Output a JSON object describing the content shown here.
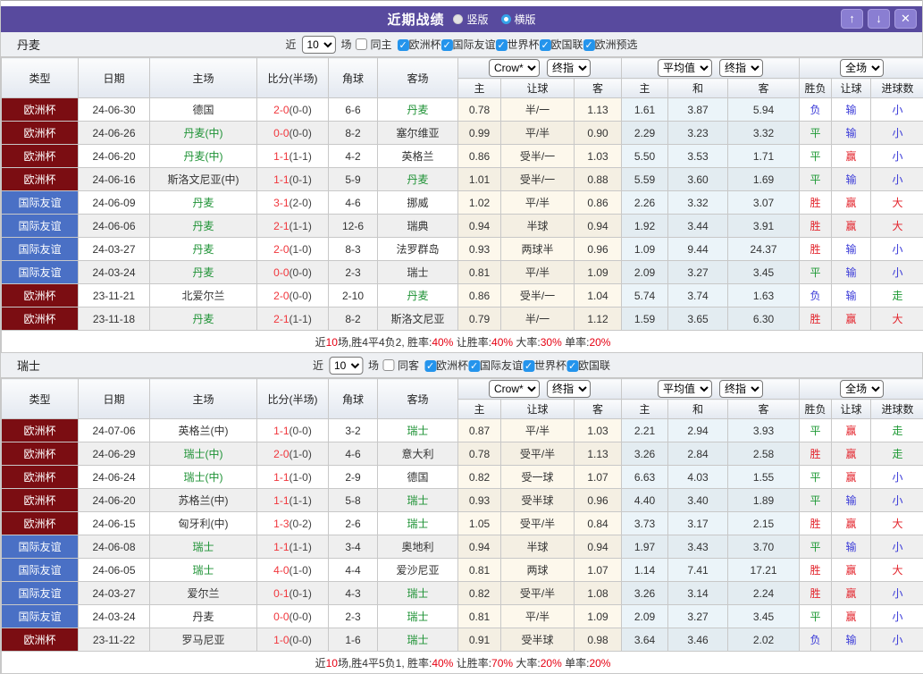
{
  "header": {
    "title": "近期战绩",
    "view_options": [
      {
        "label": "竖版",
        "selected": false
      },
      {
        "label": "横版",
        "selected": true
      }
    ],
    "window_controls": {
      "up": "↑",
      "down": "↓",
      "close": "✕"
    }
  },
  "columns": {
    "type": "类型",
    "date": "日期",
    "home": "主场",
    "score": "比分(半场)",
    "corner": "角球",
    "away": "客场",
    "odds_home": "主",
    "odds_handicap": "让球",
    "odds_away": "客",
    "avg_home": "主",
    "avg_draw": "和",
    "avg_away": "客",
    "result": "胜负",
    "result_handicap": "让球",
    "result_goals": "进球数"
  },
  "controls": {
    "bookmaker": "Crow*",
    "final_odds": "终指",
    "average": "平均值",
    "fullmatch": "全场"
  },
  "colors": {
    "accent_purple": "#584a9e",
    "europe_cup_red": "#7b0d12",
    "friendly_blue": "#4a70c5",
    "team_green": "#1e9235",
    "score_red": "#f0353b",
    "win_red": "#e3242c",
    "draw_green": "#1e9934",
    "lose_blue": "#3a3ad8",
    "summary_red": "#e60012"
  },
  "result_color_map": {
    "胜": "red",
    "赢": "red",
    "大": "red",
    "平": "green",
    "走": "green",
    "负": "blue",
    "输": "blue",
    "小": "blue"
  },
  "type_style_map": {
    "欧洲杯": "euro",
    "国际友谊": "friendly"
  },
  "sections": [
    {
      "team": "丹麦",
      "filter": {
        "near": "近",
        "count": "10",
        "games": "场",
        "same": {
          "label": "同主",
          "checked": false
        },
        "leagues": [
          {
            "label": "欧洲杯",
            "checked": true
          },
          {
            "label": "国际友谊",
            "checked": true
          },
          {
            "label": "世界杯",
            "checked": true
          },
          {
            "label": "欧国联",
            "checked": true
          },
          {
            "label": "欧洲预选",
            "checked": true
          }
        ]
      },
      "rows": [
        {
          "type": "欧洲杯",
          "date": "24-06-30",
          "home": "德国",
          "home_featured": false,
          "score_ft": "2-0",
          "score_ht": "(0-0)",
          "corner": "6-6",
          "away": "丹麦",
          "away_featured": true,
          "odds": [
            "0.78",
            "半/一",
            "1.13"
          ],
          "avg": [
            "1.61",
            "3.87",
            "5.94"
          ],
          "results": [
            "负",
            "输",
            "小"
          ]
        },
        {
          "type": "欧洲杯",
          "date": "24-06-26",
          "home": "丹麦(中)",
          "home_featured": true,
          "score_ft": "0-0",
          "score_ht": "(0-0)",
          "corner": "8-2",
          "away": "塞尔维亚",
          "away_featured": false,
          "odds": [
            "0.99",
            "平/半",
            "0.90"
          ],
          "avg": [
            "2.29",
            "3.23",
            "3.32"
          ],
          "results": [
            "平",
            "输",
            "小"
          ]
        },
        {
          "type": "欧洲杯",
          "date": "24-06-20",
          "home": "丹麦(中)",
          "home_featured": true,
          "score_ft": "1-1",
          "score_ht": "(1-1)",
          "corner": "4-2",
          "away": "英格兰",
          "away_featured": false,
          "odds": [
            "0.86",
            "受半/一",
            "1.03"
          ],
          "avg": [
            "5.50",
            "3.53",
            "1.71"
          ],
          "results": [
            "平",
            "赢",
            "小"
          ]
        },
        {
          "type": "欧洲杯",
          "date": "24-06-16",
          "home": "斯洛文尼亚(中)",
          "home_featured": false,
          "score_ft": "1-1",
          "score_ht": "(0-1)",
          "corner": "5-9",
          "away": "丹麦",
          "away_featured": true,
          "odds": [
            "1.01",
            "受半/一",
            "0.88"
          ],
          "avg": [
            "5.59",
            "3.60",
            "1.69"
          ],
          "results": [
            "平",
            "输",
            "小"
          ]
        },
        {
          "type": "国际友谊",
          "date": "24-06-09",
          "home": "丹麦",
          "home_featured": true,
          "score_ft": "3-1",
          "score_ht": "(2-0)",
          "corner": "4-6",
          "away": "挪威",
          "away_featured": false,
          "odds": [
            "1.02",
            "平/半",
            "0.86"
          ],
          "avg": [
            "2.26",
            "3.32",
            "3.07"
          ],
          "results": [
            "胜",
            "赢",
            "大"
          ]
        },
        {
          "type": "国际友谊",
          "date": "24-06-06",
          "home": "丹麦",
          "home_featured": true,
          "score_ft": "2-1",
          "score_ht": "(1-1)",
          "corner": "12-6",
          "away": "瑞典",
          "away_featured": false,
          "odds": [
            "0.94",
            "半球",
            "0.94"
          ],
          "avg": [
            "1.92",
            "3.44",
            "3.91"
          ],
          "results": [
            "胜",
            "赢",
            "大"
          ]
        },
        {
          "type": "国际友谊",
          "date": "24-03-27",
          "home": "丹麦",
          "home_featured": true,
          "score_ft": "2-0",
          "score_ht": "(1-0)",
          "corner": "8-3",
          "away": "法罗群岛",
          "away_featured": false,
          "odds": [
            "0.93",
            "两球半",
            "0.96"
          ],
          "avg": [
            "1.09",
            "9.44",
            "24.37"
          ],
          "results": [
            "胜",
            "输",
            "小"
          ]
        },
        {
          "type": "国际友谊",
          "date": "24-03-24",
          "home": "丹麦",
          "home_featured": true,
          "score_ft": "0-0",
          "score_ht": "(0-0)",
          "corner": "2-3",
          "away": "瑞士",
          "away_featured": false,
          "odds": [
            "0.81",
            "平/半",
            "1.09"
          ],
          "avg": [
            "2.09",
            "3.27",
            "3.45"
          ],
          "results": [
            "平",
            "输",
            "小"
          ]
        },
        {
          "type": "欧洲杯",
          "date": "23-11-21",
          "home": "北爱尔兰",
          "home_featured": false,
          "score_ft": "2-0",
          "score_ht": "(0-0)",
          "corner": "2-10",
          "away": "丹麦",
          "away_featured": true,
          "odds": [
            "0.86",
            "受半/一",
            "1.04"
          ],
          "avg": [
            "5.74",
            "3.74",
            "1.63"
          ],
          "results": [
            "负",
            "输",
            "走"
          ]
        },
        {
          "type": "欧洲杯",
          "date": "23-11-18",
          "home": "丹麦",
          "home_featured": true,
          "score_ft": "2-1",
          "score_ht": "(1-1)",
          "corner": "8-2",
          "away": "斯洛文尼亚",
          "away_featured": false,
          "odds": [
            "0.79",
            "半/一",
            "1.12"
          ],
          "avg": [
            "1.59",
            "3.65",
            "6.30"
          ],
          "results": [
            "胜",
            "赢",
            "大"
          ]
        }
      ],
      "summary": [
        {
          "text": "近"
        },
        {
          "text": "10",
          "red": true
        },
        {
          "text": "场,胜4平4负2, 胜率:"
        },
        {
          "text": "40%",
          "red": true
        },
        {
          "text": " 让胜率:"
        },
        {
          "text": "40%",
          "red": true
        },
        {
          "text": " 大率:"
        },
        {
          "text": "30%",
          "red": true
        },
        {
          "text": " 单率:"
        },
        {
          "text": "20%",
          "red": true
        }
      ]
    },
    {
      "team": "瑞士",
      "filter": {
        "near": "近",
        "count": "10",
        "games": "场",
        "same": {
          "label": "同客",
          "checked": false
        },
        "leagues": [
          {
            "label": "欧洲杯",
            "checked": true
          },
          {
            "label": "国际友谊",
            "checked": true
          },
          {
            "label": "世界杯",
            "checked": true
          },
          {
            "label": "欧国联",
            "checked": true
          }
        ]
      },
      "rows": [
        {
          "type": "欧洲杯",
          "date": "24-07-06",
          "home": "英格兰(中)",
          "home_featured": false,
          "score_ft": "1-1",
          "score_ht": "(0-0)",
          "corner": "3-2",
          "away": "瑞士",
          "away_featured": true,
          "odds": [
            "0.87",
            "平/半",
            "1.03"
          ],
          "avg": [
            "2.21",
            "2.94",
            "3.93"
          ],
          "results": [
            "平",
            "赢",
            "走"
          ]
        },
        {
          "type": "欧洲杯",
          "date": "24-06-29",
          "home": "瑞士(中)",
          "home_featured": true,
          "score_ft": "2-0",
          "score_ht": "(1-0)",
          "corner": "4-6",
          "away": "意大利",
          "away_featured": false,
          "odds": [
            "0.78",
            "受平/半",
            "1.13"
          ],
          "avg": [
            "3.26",
            "2.84",
            "2.58"
          ],
          "results": [
            "胜",
            "赢",
            "走"
          ]
        },
        {
          "type": "欧洲杯",
          "date": "24-06-24",
          "home": "瑞士(中)",
          "home_featured": true,
          "score_ft": "1-1",
          "score_ht": "(1-0)",
          "corner": "2-9",
          "away": "德国",
          "away_featured": false,
          "odds": [
            "0.82",
            "受一球",
            "1.07"
          ],
          "avg": [
            "6.63",
            "4.03",
            "1.55"
          ],
          "results": [
            "平",
            "赢",
            "小"
          ]
        },
        {
          "type": "欧洲杯",
          "date": "24-06-20",
          "home": "苏格兰(中)",
          "home_featured": false,
          "score_ft": "1-1",
          "score_ht": "(1-1)",
          "corner": "5-8",
          "away": "瑞士",
          "away_featured": true,
          "odds": [
            "0.93",
            "受半球",
            "0.96"
          ],
          "avg": [
            "4.40",
            "3.40",
            "1.89"
          ],
          "results": [
            "平",
            "输",
            "小"
          ]
        },
        {
          "type": "欧洲杯",
          "date": "24-06-15",
          "home": "匈牙利(中)",
          "home_featured": false,
          "score_ft": "1-3",
          "score_ht": "(0-2)",
          "corner": "2-6",
          "away": "瑞士",
          "away_featured": true,
          "odds": [
            "1.05",
            "受平/半",
            "0.84"
          ],
          "avg": [
            "3.73",
            "3.17",
            "2.15"
          ],
          "results": [
            "胜",
            "赢",
            "大"
          ]
        },
        {
          "type": "国际友谊",
          "date": "24-06-08",
          "home": "瑞士",
          "home_featured": true,
          "score_ft": "1-1",
          "score_ht": "(1-1)",
          "corner": "3-4",
          "away": "奥地利",
          "away_featured": false,
          "odds": [
            "0.94",
            "半球",
            "0.94"
          ],
          "avg": [
            "1.97",
            "3.43",
            "3.70"
          ],
          "results": [
            "平",
            "输",
            "小"
          ]
        },
        {
          "type": "国际友谊",
          "date": "24-06-05",
          "home": "瑞士",
          "home_featured": true,
          "score_ft": "4-0",
          "score_ht": "(1-0)",
          "corner": "4-4",
          "away": "爱沙尼亚",
          "away_featured": false,
          "odds": [
            "0.81",
            "两球",
            "1.07"
          ],
          "avg": [
            "1.14",
            "7.41",
            "17.21"
          ],
          "results": [
            "胜",
            "赢",
            "大"
          ]
        },
        {
          "type": "国际友谊",
          "date": "24-03-27",
          "home": "爱尔兰",
          "home_featured": false,
          "score_ft": "0-1",
          "score_ht": "(0-1)",
          "corner": "4-3",
          "away": "瑞士",
          "away_featured": true,
          "odds": [
            "0.82",
            "受平/半",
            "1.08"
          ],
          "avg": [
            "3.26",
            "3.14",
            "2.24"
          ],
          "results": [
            "胜",
            "赢",
            "小"
          ]
        },
        {
          "type": "国际友谊",
          "date": "24-03-24",
          "home": "丹麦",
          "home_featured": false,
          "score_ft": "0-0",
          "score_ht": "(0-0)",
          "corner": "2-3",
          "away": "瑞士",
          "away_featured": true,
          "odds": [
            "0.81",
            "平/半",
            "1.09"
          ],
          "avg": [
            "2.09",
            "3.27",
            "3.45"
          ],
          "results": [
            "平",
            "赢",
            "小"
          ]
        },
        {
          "type": "欧洲杯",
          "date": "23-11-22",
          "home": "罗马尼亚",
          "home_featured": false,
          "score_ft": "1-0",
          "score_ht": "(0-0)",
          "corner": "1-6",
          "away": "瑞士",
          "away_featured": true,
          "odds": [
            "0.91",
            "受半球",
            "0.98"
          ],
          "avg": [
            "3.64",
            "3.46",
            "2.02"
          ],
          "results": [
            "负",
            "输",
            "小"
          ]
        }
      ],
      "summary": [
        {
          "text": "近"
        },
        {
          "text": "10",
          "red": true
        },
        {
          "text": "场,胜4平5负1, 胜率:"
        },
        {
          "text": "40%",
          "red": true
        },
        {
          "text": " 让胜率:"
        },
        {
          "text": "70%",
          "red": true
        },
        {
          "text": " 大率:"
        },
        {
          "text": "20%",
          "red": true
        },
        {
          "text": " 单率:"
        },
        {
          "text": "20%",
          "red": true
        }
      ]
    }
  ]
}
